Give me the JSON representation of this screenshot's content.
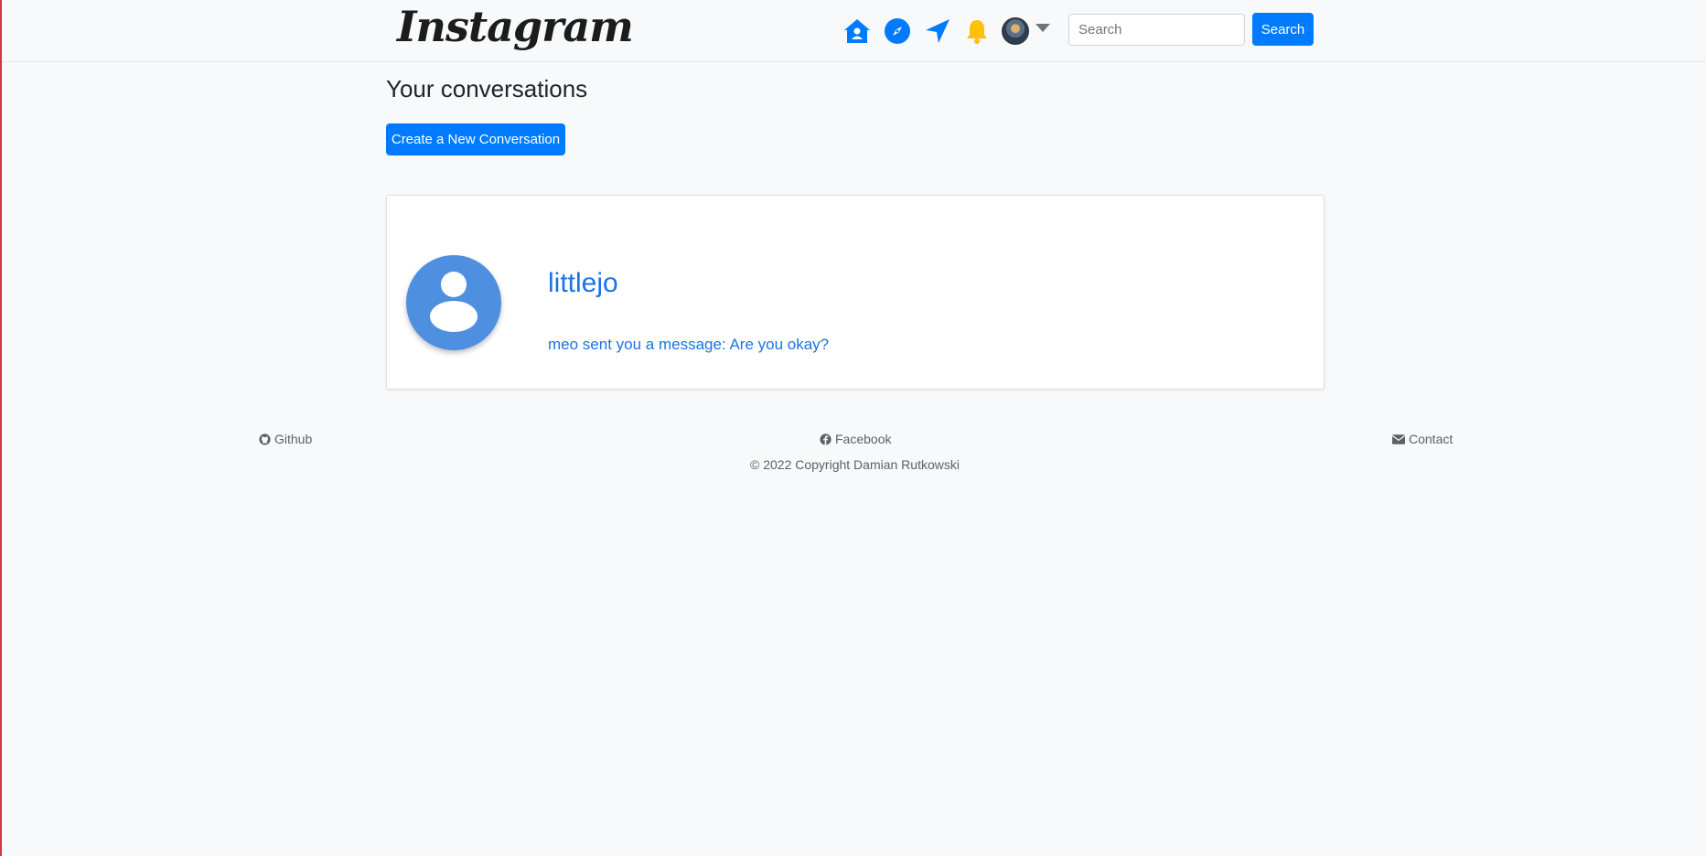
{
  "navbar": {
    "logo_text": "Instagram",
    "icons": [
      "home-icon",
      "compass-icon",
      "send-icon",
      "bell-icon"
    ],
    "search_placeholder": "Search",
    "search_button": "Search"
  },
  "main": {
    "title": "Your conversations",
    "create_button": "Create a New Conversation",
    "conversations": [
      {
        "username": "littlejo",
        "last_message": "meo sent you a message: Are you okay?"
      }
    ]
  },
  "footer": {
    "github": "Github",
    "facebook": "Facebook",
    "contact": "Contact",
    "copyright": "© 2022 Copyright Damian Rutkowski"
  },
  "colors": {
    "primary": "#007bff",
    "link": "#1a73e8",
    "bell": "#ffc107",
    "background": "#f8f9fa"
  }
}
